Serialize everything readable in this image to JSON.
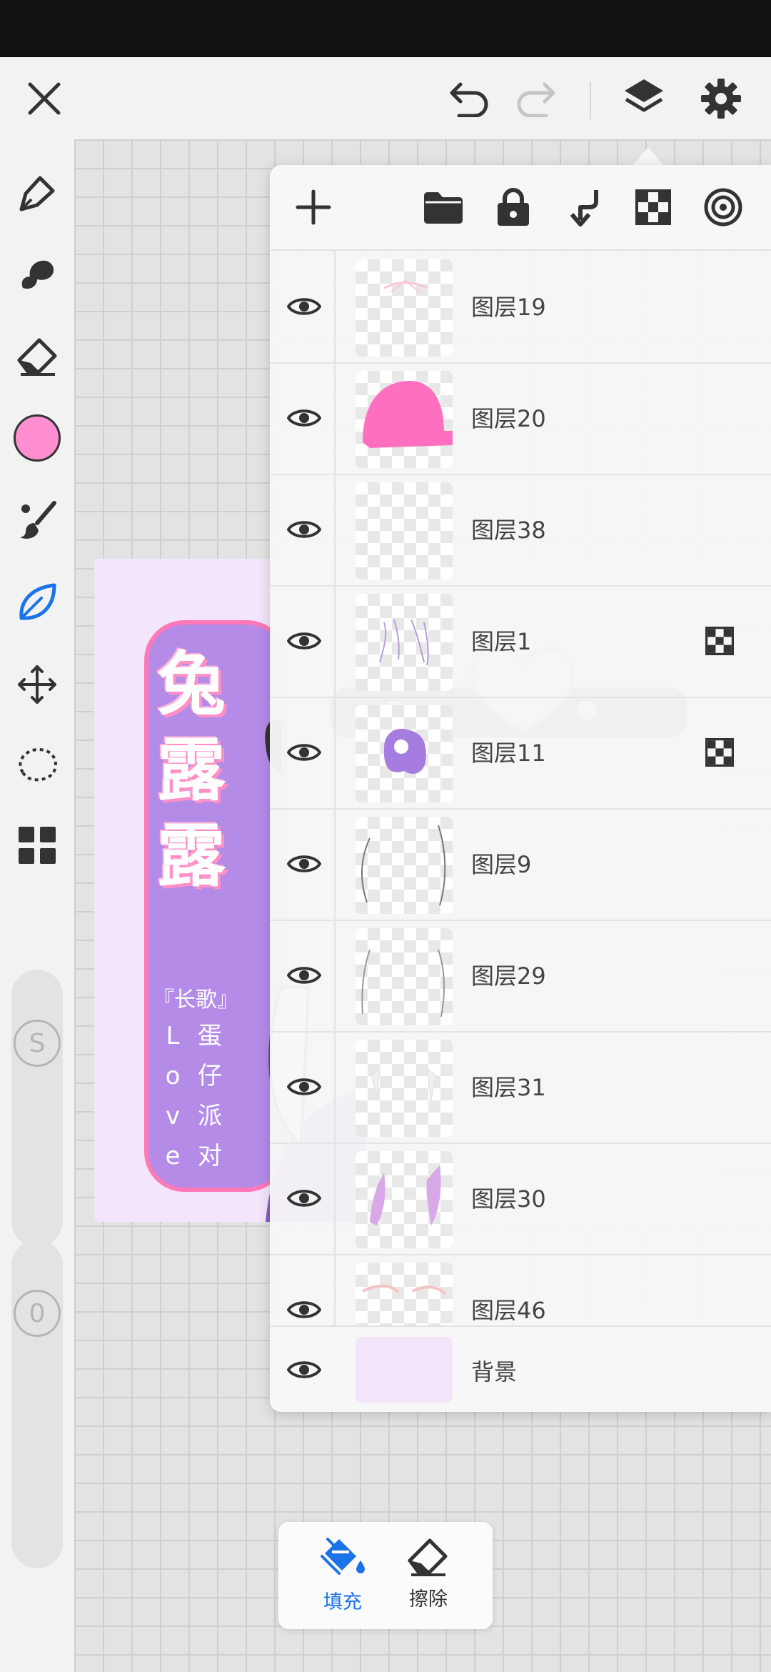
{
  "colors": {
    "accent": "#1a73e8",
    "brush_color": "#ff8fd0",
    "icon": "#333333",
    "artwork_bg": "#f3e6fb"
  },
  "header": {
    "close_icon": "close-icon",
    "undo_icon": "undo-icon",
    "redo_icon": "redo-icon",
    "layers_icon": "layers-icon",
    "settings_icon": "gear-icon"
  },
  "left_toolbar": {
    "tools": [
      "pen-icon",
      "smudge-icon",
      "eraser-icon",
      "color-swatch",
      "brush-icon",
      "leaf-icon",
      "move-icon",
      "lasso-icon",
      "grid-icon"
    ],
    "size_label": "S",
    "opacity_label": "0"
  },
  "artwork": {
    "title": "兔露露",
    "subtitle": "『长歌』",
    "vertical_left": [
      "L",
      "o",
      "v",
      "e"
    ],
    "vertical_right": [
      "蛋",
      "仔",
      "派",
      "对"
    ]
  },
  "layers_panel": {
    "toolbar": [
      "add-icon",
      "folder-icon",
      "lock-icon",
      "merge-down-icon",
      "alpha-lock-icon",
      "target-icon"
    ],
    "layers": [
      {
        "name": "图层19",
        "clipping": false
      },
      {
        "name": "图层20",
        "clipping": false
      },
      {
        "name": "图层38",
        "clipping": false
      },
      {
        "name": "图层1",
        "clipping": true
      },
      {
        "name": "图层11",
        "clipping": true
      },
      {
        "name": "图层9",
        "clipping": false
      },
      {
        "name": "图层29",
        "clipping": false
      },
      {
        "name": "图层31",
        "clipping": false
      },
      {
        "name": "图层30",
        "clipping": false
      },
      {
        "name": "图层46",
        "clipping": false
      }
    ],
    "background_layer": "背景"
  },
  "fill_popup": {
    "fill_label": "填充",
    "erase_label": "擦除"
  }
}
